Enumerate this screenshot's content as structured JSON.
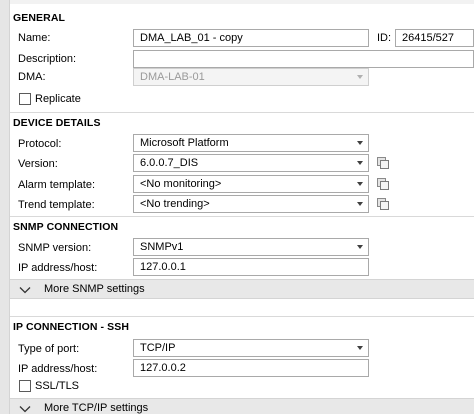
{
  "general": {
    "title": "GENERAL",
    "name_label": "Name:",
    "name_value": "DMA_LAB_01 - copy",
    "id_label": "ID:",
    "id_value": "26415/527",
    "description_label": "Description:",
    "description_value": "",
    "dma_label": "DMA:",
    "dma_value": "DMA-LAB-01",
    "replicate_label": "Replicate",
    "replicate_checked": false
  },
  "device": {
    "title": "DEVICE DETAILS",
    "protocol_label": "Protocol:",
    "protocol_value": "Microsoft Platform",
    "version_label": "Version:",
    "version_value": "6.0.0.7_DIS",
    "alarm_label": "Alarm template:",
    "alarm_value": "<No monitoring>",
    "trend_label": "Trend template:",
    "trend_value": "<No trending>"
  },
  "snmp": {
    "title": "SNMP CONNECTION",
    "version_label": "SNMP version:",
    "version_value": "SNMPv1",
    "ip_label": "IP address/host:",
    "ip_value": "127.0.0.1",
    "more_label": "More SNMP settings"
  },
  "ip": {
    "title": "IP CONNECTION - SSH",
    "port_label": "Type of port:",
    "port_value": "TCP/IP",
    "ip_label": "IP address/host:",
    "ip_value": "127.0.0.2",
    "ssl_label": "SSL/TLS",
    "ssl_checked": false,
    "more_label": "More TCP/IP settings"
  },
  "icons": {
    "copy": "copy-icon",
    "chevron": "chevron-down-icon",
    "dropdown": "dropdown-caret-icon"
  },
  "colors": {
    "expander_bg": "#e8e8e8",
    "field_border": "#a9a9a9",
    "disabled_text": "#9a9a9a"
  }
}
